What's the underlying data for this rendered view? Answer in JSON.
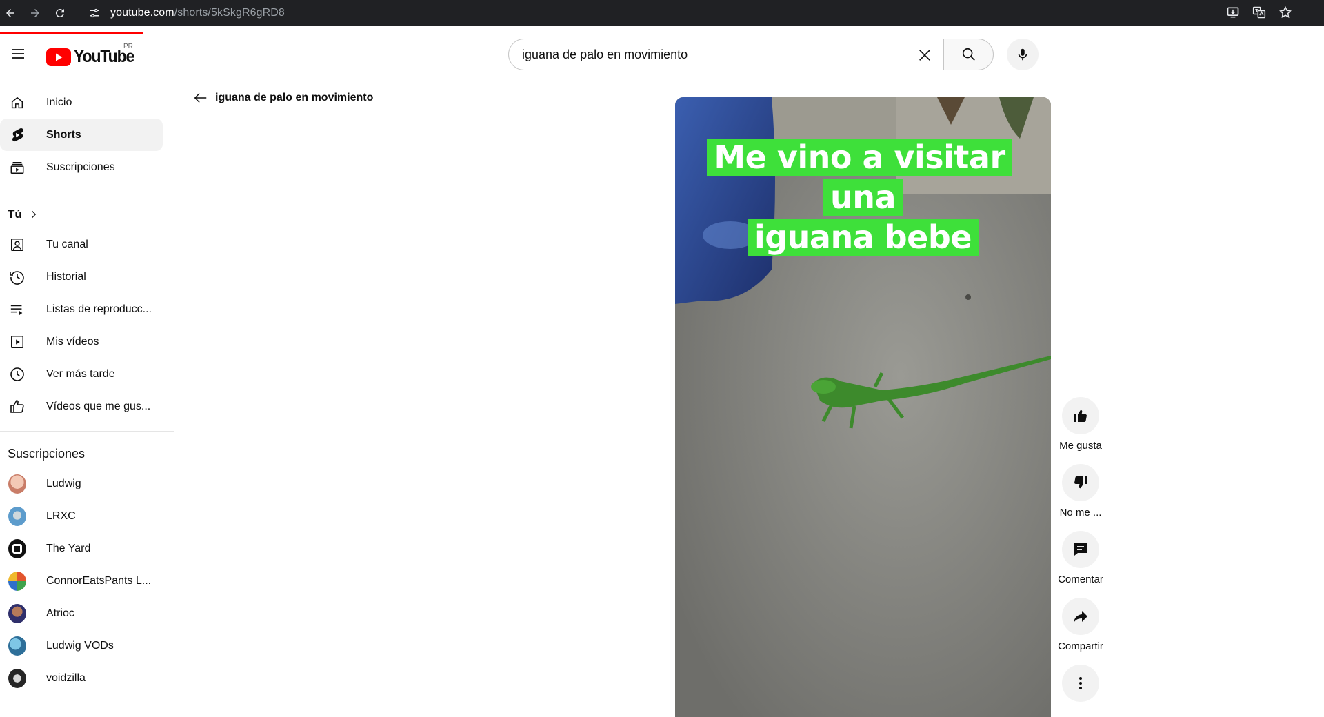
{
  "browser": {
    "url_host": "youtube.com",
    "url_path": "/shorts/5kSkgR6gRD8"
  },
  "masthead": {
    "logo_text": "YouTube",
    "region": "PR",
    "search_value": "iguana de palo en movimiento"
  },
  "sidebar": {
    "main_items": [
      {
        "label": "Inicio",
        "icon": "home-icon"
      },
      {
        "label": "Shorts",
        "icon": "shorts-icon"
      },
      {
        "label": "Suscripciones",
        "icon": "subscriptions-icon"
      }
    ],
    "you_section": "Tú",
    "you_items": [
      {
        "label": "Tu canal",
        "icon": "channel-icon"
      },
      {
        "label": "Historial",
        "icon": "history-icon"
      },
      {
        "label": "Listas de reproducc...",
        "icon": "playlists-icon"
      },
      {
        "label": "Mis vídeos",
        "icon": "my-videos-icon"
      },
      {
        "label": "Ver más tarde",
        "icon": "watch-later-icon"
      },
      {
        "label": "Vídeos que me gus...",
        "icon": "liked-videos-icon"
      }
    ],
    "subscriptions_title": "Suscripciones",
    "subscriptions": [
      {
        "label": "Ludwig",
        "color": "#e8b4a0"
      },
      {
        "label": "LRXC",
        "color": "#6aa7d8"
      },
      {
        "label": "The Yard",
        "color": "#111111"
      },
      {
        "label": "ConnorEatsPants L...",
        "color": "#d9672e"
      },
      {
        "label": "Atrioc",
        "color": "#3b3b70"
      },
      {
        "label": "Ludwig VODs",
        "color": "#3f8fb8"
      },
      {
        "label": "voidzilla",
        "color": "#2b2b2b"
      }
    ]
  },
  "main": {
    "back_label": "iguana de palo en movimiento",
    "video_caption_line1": "Me vino a visitar una",
    "video_caption_line2": "iguana bebe",
    "caption_bg": "#3ee03a"
  },
  "actions": {
    "like": "Me gusta",
    "dislike": "No me ...",
    "comment": "Comentar",
    "share": "Compartir"
  },
  "colors": {
    "brand_red": "#ff0000",
    "active_bg": "#f2f2f2"
  }
}
